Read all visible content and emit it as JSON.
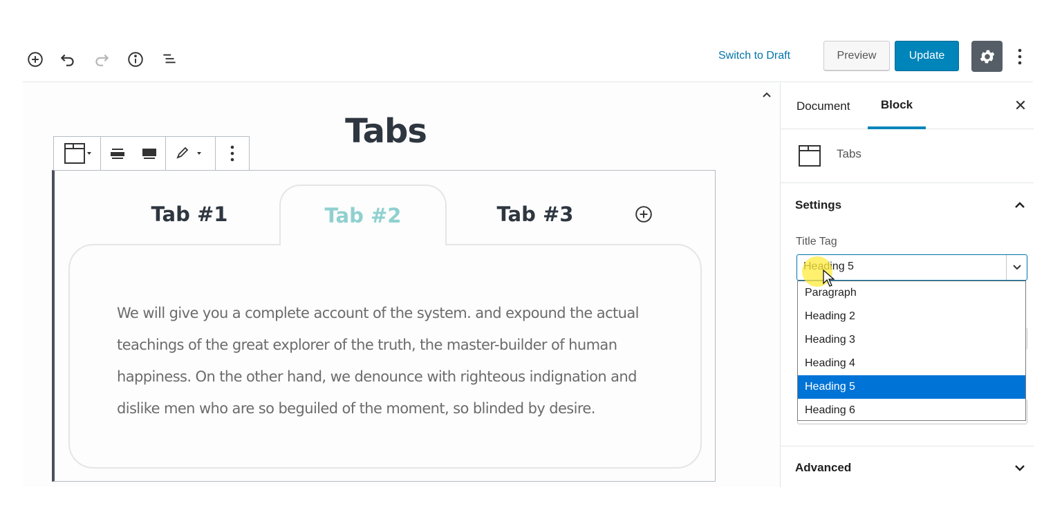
{
  "topbar": {
    "add_block_icon": "plus-circle-icon",
    "undo_icon": "undo-icon",
    "redo_icon": "redo-icon",
    "info_icon": "info-icon",
    "outline_icon": "list-outline-icon",
    "switch_to_draft": "Switch to Draft",
    "preview": "Preview",
    "update": "Update",
    "settings_icon": "gear-icon",
    "more_icon": "vertical-ellipsis-icon"
  },
  "editor": {
    "post_title": "Tabs",
    "block_toolbar": {
      "block_type_icon": "tabs-block-icon",
      "align_center_icon": "align-center-icon",
      "align_wide_icon": "align-wide-icon",
      "style_icon": "pencil-icon",
      "more_icon": "vertical-ellipsis-icon"
    },
    "tabs": [
      {
        "label": "Tab #1"
      },
      {
        "label": "Tab #2"
      },
      {
        "label": "Tab #3"
      }
    ],
    "active_tab_index": 1,
    "add_tab_icon": "plus-circle-icon",
    "tab_content": "We will give you a complete account of the system. and expound the actual teachings of the great explorer of the truth, the master-builder of human happiness. On the other hand, we denounce with righteous indignation and dislike men who are so beguiled of the moment, so blinded by desire."
  },
  "sidebar": {
    "tabs": {
      "document": "Document",
      "block": "Block"
    },
    "active_tab": "Block",
    "close_icon": "close-icon",
    "block_name": "Tabs",
    "settings": {
      "heading": "Settings",
      "title_tag_label": "Title Tag",
      "title_tag_value": "Heading 5",
      "options": [
        "Paragraph",
        "Heading 2",
        "Heading 3",
        "Heading 4",
        "Heading 5",
        "Heading 6"
      ],
      "selected_option": "Heading 5"
    },
    "advanced": {
      "heading": "Advanced"
    }
  },
  "colors": {
    "accent": "#0085ba",
    "link": "#0073aa",
    "active_tab_text": "#8fd0cf",
    "dropdown_selected": "#0073d6"
  }
}
